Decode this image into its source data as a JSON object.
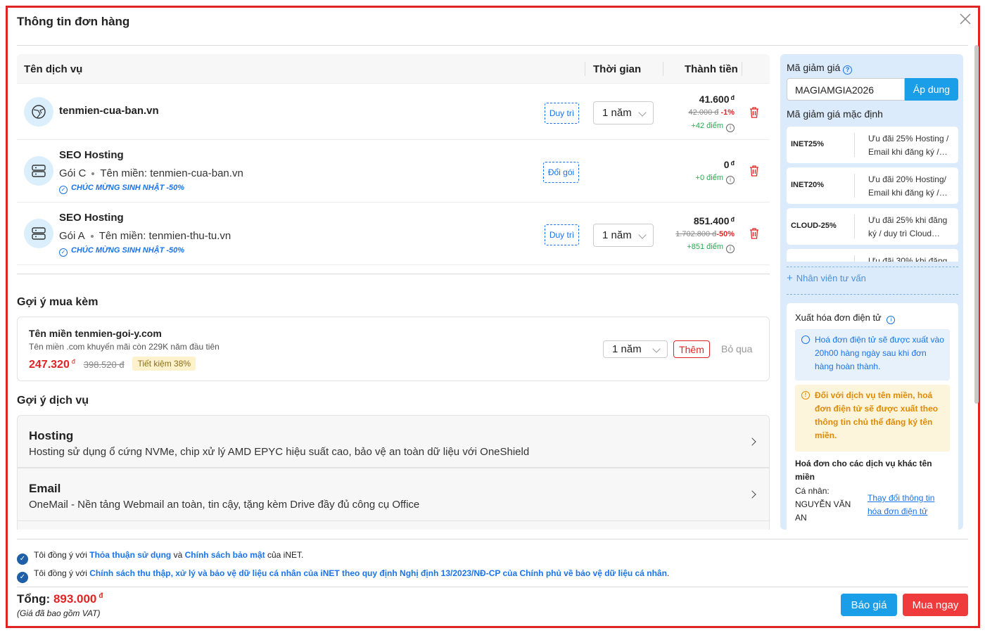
{
  "dialog": {
    "title": "Thông tin đơn hàng"
  },
  "table": {
    "headers": {
      "service": "Tên dịch vụ",
      "duration": "Thời gian",
      "amount": "Thành tiền"
    },
    "rows": [
      {
        "name": "tenmien-cua-ban.vn",
        "action": "Duy trì",
        "duration": "1 năm",
        "price": "41.600",
        "currency": "đ",
        "old_price": "42.000 đ",
        "discount": "-1%",
        "points": "+42 điểm"
      },
      {
        "name": "SEO Hosting",
        "plan": "Gói C",
        "domain_label": "Tên miền: tenmien-cua-ban.vn",
        "promo": "CHÚC MỪNG SINH NHẬT -50%",
        "action": "Đổi gói",
        "price": "0",
        "currency": "đ",
        "points": "+0 điểm"
      },
      {
        "name": "SEO Hosting",
        "plan": "Gói A",
        "domain_label": "Tên miền: tenmien-thu-tu.vn",
        "promo": "CHÚC MỪNG SINH NHẬT -50%",
        "action": "Duy trì",
        "duration": "1 năm",
        "price": "851.400",
        "currency": "đ",
        "old_price": "1.702.800 đ",
        "discount": "-50%",
        "points": "+851 điểm"
      }
    ]
  },
  "upsell": {
    "title": "Gợi ý mua kèm",
    "item": {
      "name": "Tên miền tenmien-goi-y.com",
      "desc": "Tên miền .com khuyến mãi còn 229K năm đầu tiên",
      "price": "247.320",
      "currency": "đ",
      "old_price": "398.520 đ",
      "saving": "Tiết kiệm 38%",
      "duration": "1 năm",
      "add_label": "Thêm",
      "skip_label": "Bỏ qua"
    }
  },
  "services": {
    "title": "Gợi ý dịch vụ",
    "items": [
      {
        "name": "Hosting",
        "desc": "Hosting sử dụng ổ cứng NVMe, chip xử lý AMD EPYC hiệu suất cao, bảo vệ an toàn dữ liệu với OneShield"
      },
      {
        "name": "Email",
        "desc": "OneMail - Nền tảng Webmail an toàn, tin cậy, tặng kèm Drive đầy đủ công cụ Office"
      }
    ]
  },
  "coupon": {
    "label": "Mã giảm giá",
    "value": "MAGIAMGIA2026",
    "apply_label": "Áp dung",
    "default_label": "Mã giảm giá mặc định",
    "defaults": [
      {
        "code": "INET25%",
        "desc": "Ưu đãi 25% Hosting / Email khi đăng ký /…"
      },
      {
        "code": "INET20%",
        "desc": "Ưu đãi 20% Hosting/ Email khi đăng ký /…"
      },
      {
        "code": "CLOUD-25%",
        "desc": "Ưu đãi 25% khi đăng ký / duy trì Cloud…"
      },
      {
        "code": "",
        "desc": "Ưu đãi 30% khi đăng"
      }
    ],
    "staff_label": "Nhân viên tư vấn"
  },
  "invoice": {
    "title": "Xuất hóa đơn điện tử",
    "note_time": "Hoá đơn điện tử sẽ được xuất vào 20h00 hàng ngày sau khi đơn hàng hoàn thành.",
    "note_domain": "Đối với dịch vụ tên miền, hoá đơn điện tử sẽ được xuất theo thông tin chủ thể đăng ký tên miền.",
    "other_title": "Hoá đơn cho các dịch vụ khác tên miền",
    "person_label": "Cá nhân:",
    "person_name": "NGUYỄN VĂN AN",
    "change_link": "Thay đổi thông tin hóa đơn điện tử"
  },
  "agreements": {
    "a1_prefix": "Tôi đồng ý với ",
    "a1_link1": "Thỏa thuận sử dụng",
    "a1_mid": " và ",
    "a1_link2": "Chính sách bảo mật",
    "a1_suffix": " của iNET.",
    "a2_prefix": "Tôi đồng ý với ",
    "a2_link": "Chính sách thu thập, xử lý và bảo vệ dữ liệu cá nhân của iNET theo quy định Nghị định 13/2023/NĐ-CP của Chính phủ về bảo vệ dữ liệu cá nhân",
    "a2_suffix": "."
  },
  "footer": {
    "total_label": "Tổng:",
    "total_value": "893.000",
    "currency": "đ",
    "vat_note": "(Giá đã bao gồm VAT)",
    "quote_label": "Báo giá",
    "buy_label": "Mua ngay"
  },
  "colors": {
    "accent": "#1a9ee8",
    "danger": "#e02424",
    "panel": "#dcebfb",
    "success": "#1fae4b"
  }
}
